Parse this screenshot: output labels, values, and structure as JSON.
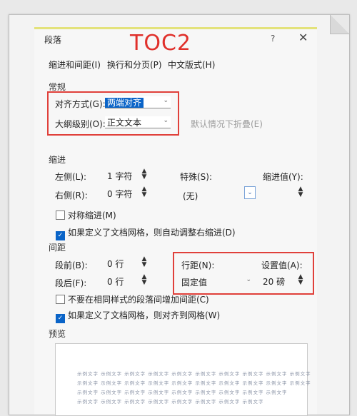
{
  "dialog": {
    "title": "段落",
    "overlay_label": "TOC2",
    "help_icon": "?",
    "close_icon": "✕"
  },
  "tabs": [
    "缩进和间距(I)",
    "换行和分页(P)",
    "中文版式(H)"
  ],
  "general": {
    "heading": "常规",
    "alignment_label": "对齐方式(G):",
    "alignment_value": "两端对齐",
    "outline_label": "大纲级别(O):",
    "outline_value": "正文文本",
    "collapse_label": "默认情况下折叠(E)"
  },
  "indent": {
    "heading": "缩进",
    "left_label": "左侧(L):",
    "left_value": "1 字符",
    "right_label": "右侧(R):",
    "right_value": "0 字符",
    "special_label": "特殊(S):",
    "special_value": "(无)",
    "indent_value_label": "缩进值(Y):",
    "mirror_label": "对称缩进(M)",
    "auto_adjust_label": "如果定义了文档网格，则自动调整右缩进(D)"
  },
  "spacing": {
    "heading": "间距",
    "before_label": "段前(B):",
    "before_value": "0 行",
    "after_label": "段后(F):",
    "after_value": "0 行",
    "line_spacing_label": "行距(N):",
    "line_spacing_value": "固定值",
    "setting_label": "设置值(A):",
    "setting_value": "20 磅",
    "no_space_same_style_label": "不要在相同样式的段落间增加间距(C)",
    "snap_to_grid_label": "如果定义了文档网格，则对齐到网格(W)"
  },
  "preview": {
    "heading": "预览",
    "lines": [
      "示例文字 示例文字 示例文字 示例文字 示例文字 示例文字 示例文字 示例文字 示例文字 示例文字",
      "示例文字 示例文字 示例文字 示例文字 示例文字 示例文字 示例文字 示例文字 示例文字 示例文字",
      "示例文字 示例文字 示例文字 示例文字 示例文字 示例文字 示例文字 示例文字 示例文字",
      "示例文字 示例文字 示例文字 示例文字 示例文字 示例文字 示例文字 示例文字"
    ]
  },
  "colors": {
    "highlight": "#e0403a",
    "selection": "#0a64c8",
    "accent_bar": "#e3e27a"
  }
}
